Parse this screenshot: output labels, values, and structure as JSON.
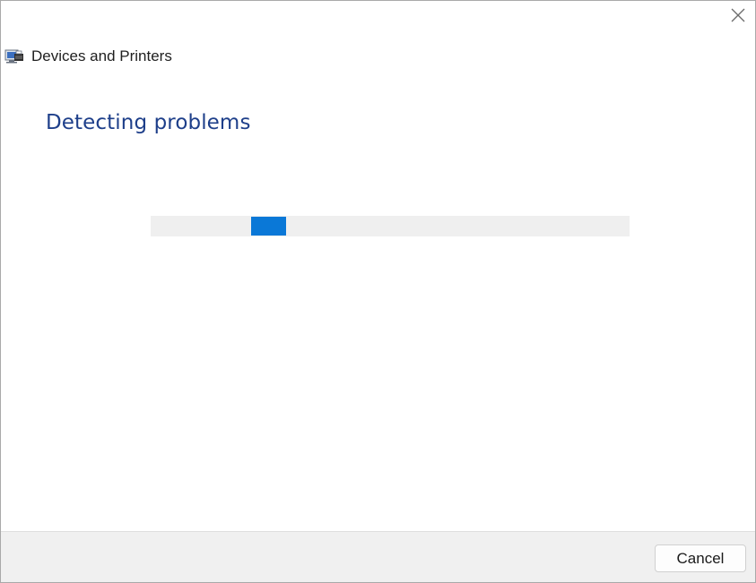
{
  "window": {
    "close_icon": "close-icon"
  },
  "header": {
    "app_icon": "devices-and-printers-icon",
    "app_title": "Devices and Printers"
  },
  "main": {
    "heading": "Detecting problems",
    "progress": {
      "mode": "indeterminate",
      "chunk_position_fraction": 0.21,
      "chunk_width_fraction": 0.073,
      "accent_color": "#0a78d7",
      "track_color": "#efefef"
    }
  },
  "footer": {
    "cancel_label": "Cancel"
  },
  "colors": {
    "heading": "#1e3f8a",
    "footer_bg": "#f0f0f0"
  }
}
